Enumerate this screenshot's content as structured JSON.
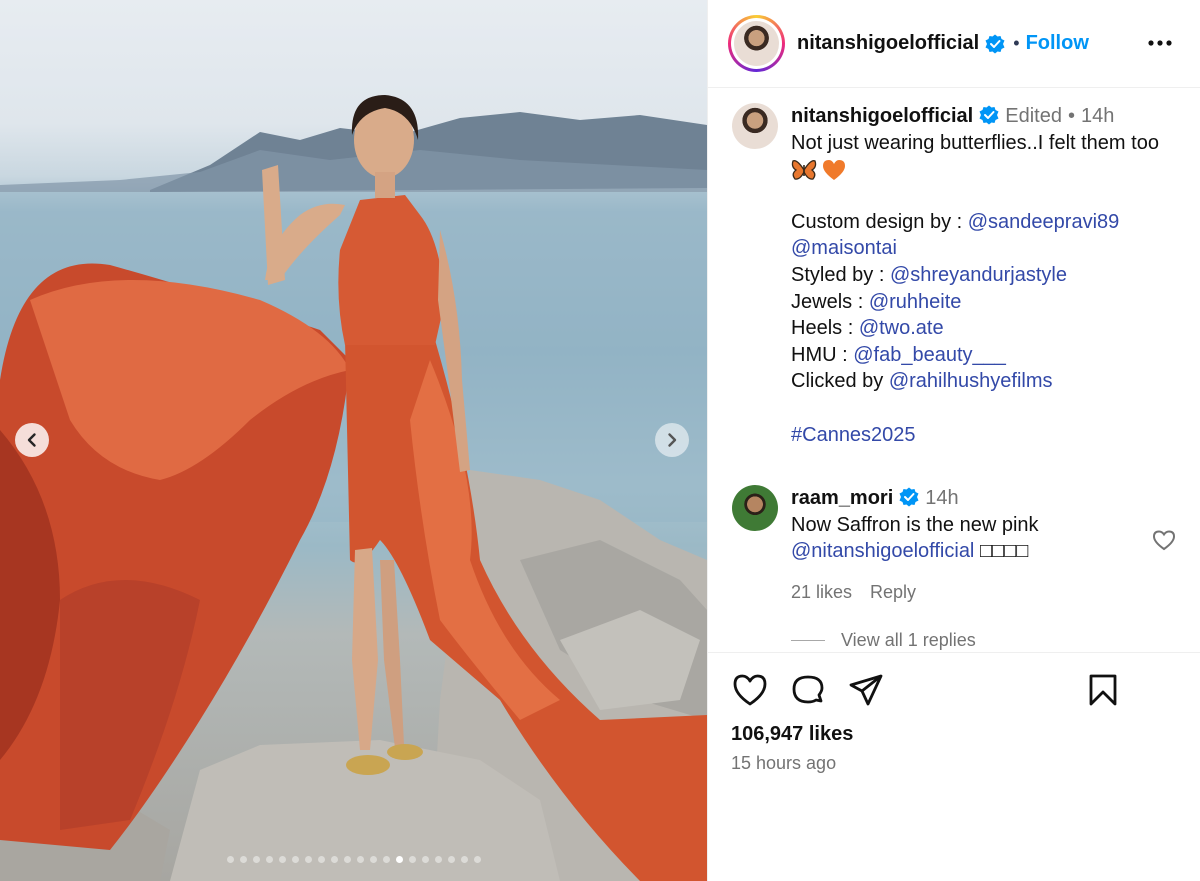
{
  "post": {
    "author": "nitanshigoelofficial",
    "follow_label": "Follow",
    "separator": "•",
    "carousel": {
      "total_slides": 20,
      "active_index": 13
    }
  },
  "caption": {
    "username": "nitanshigoelofficial",
    "edited": "Edited",
    "dot": "•",
    "time": "14h",
    "text": "Not just wearing butterflies..I felt them too",
    "emojis": [
      "butterfly-emoji",
      "orange-heart-emoji"
    ],
    "credits": [
      {
        "label": "Custom design by : ",
        "mention": "@sandeepravi89"
      },
      {
        "label": "",
        "mention": "@maisontai"
      },
      {
        "label": "Styled by : ",
        "mention": "@shreyandurjastyle"
      },
      {
        "label": "Jewels : ",
        "mention": "@ruhheite"
      },
      {
        "label": "Heels : ",
        "mention": "@two.ate"
      },
      {
        "label": "HMU : ",
        "mention": "@fab_beauty___"
      },
      {
        "label": "Clicked by ",
        "mention": "@rahilhushyefilms"
      }
    ],
    "hashtag": "#Cannes2025"
  },
  "comment": {
    "username": "raam_mori",
    "time": "14h",
    "text": "Now Saffron is the new pink",
    "mention": "@nitanshigoelofficial",
    "trailing": "□□□□",
    "likes": "21 likes",
    "reply_label": "Reply",
    "view_replies": "View all 1 replies"
  },
  "footer": {
    "likes": "106,947 likes",
    "timestamp": "15 hours ago"
  },
  "colors": {
    "link": "#0095f6",
    "mention": "#3349a8",
    "secondary_text": "#737373",
    "dress": "#d65a34",
    "verified": "#0095f6"
  }
}
